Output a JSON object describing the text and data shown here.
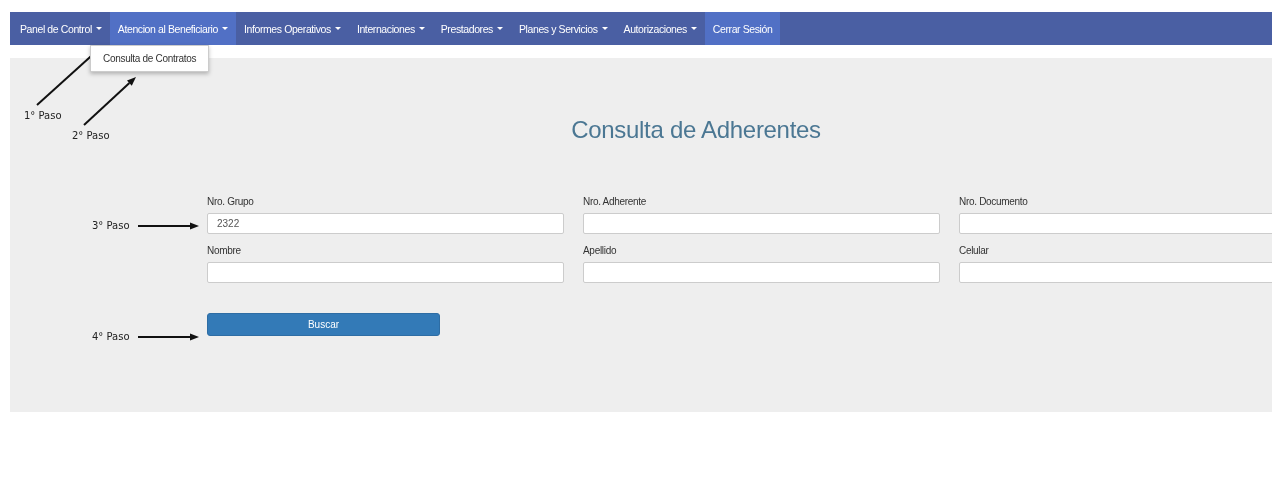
{
  "navbar": {
    "items": [
      {
        "label": "Panel de Control",
        "kind": "dropdown",
        "selected": false
      },
      {
        "label": "Atencion al Beneficiario",
        "kind": "dropdown",
        "selected": true,
        "menu": [
          "Consulta de Contratos"
        ]
      },
      {
        "label": "Informes Operativos",
        "kind": "dropdown",
        "selected": false
      },
      {
        "label": "Internaciones",
        "kind": "dropdown",
        "selected": false
      },
      {
        "label": "Prestadores",
        "kind": "dropdown",
        "selected": false
      },
      {
        "label": "Planes y Servicios",
        "kind": "dropdown",
        "selected": false
      },
      {
        "label": "Autorizaciones",
        "kind": "dropdown",
        "selected": false
      },
      {
        "label": "Cerrar Sesión",
        "kind": "link",
        "selected": true
      }
    ]
  },
  "title": "Consulta de Adherentes",
  "form": {
    "fields": [
      {
        "label": "Nro. Grupo",
        "value": "2322"
      },
      {
        "label": "Nro. Adherente"
      },
      {
        "label": "Nro. Documento"
      },
      {
        "label": "Nombre"
      },
      {
        "label": "Apellido"
      },
      {
        "label": "Celular"
      }
    ],
    "button": "Buscar"
  },
  "annotations": [
    "1° Paso",
    "2° Paso",
    "3° Paso",
    "4° Paso"
  ]
}
